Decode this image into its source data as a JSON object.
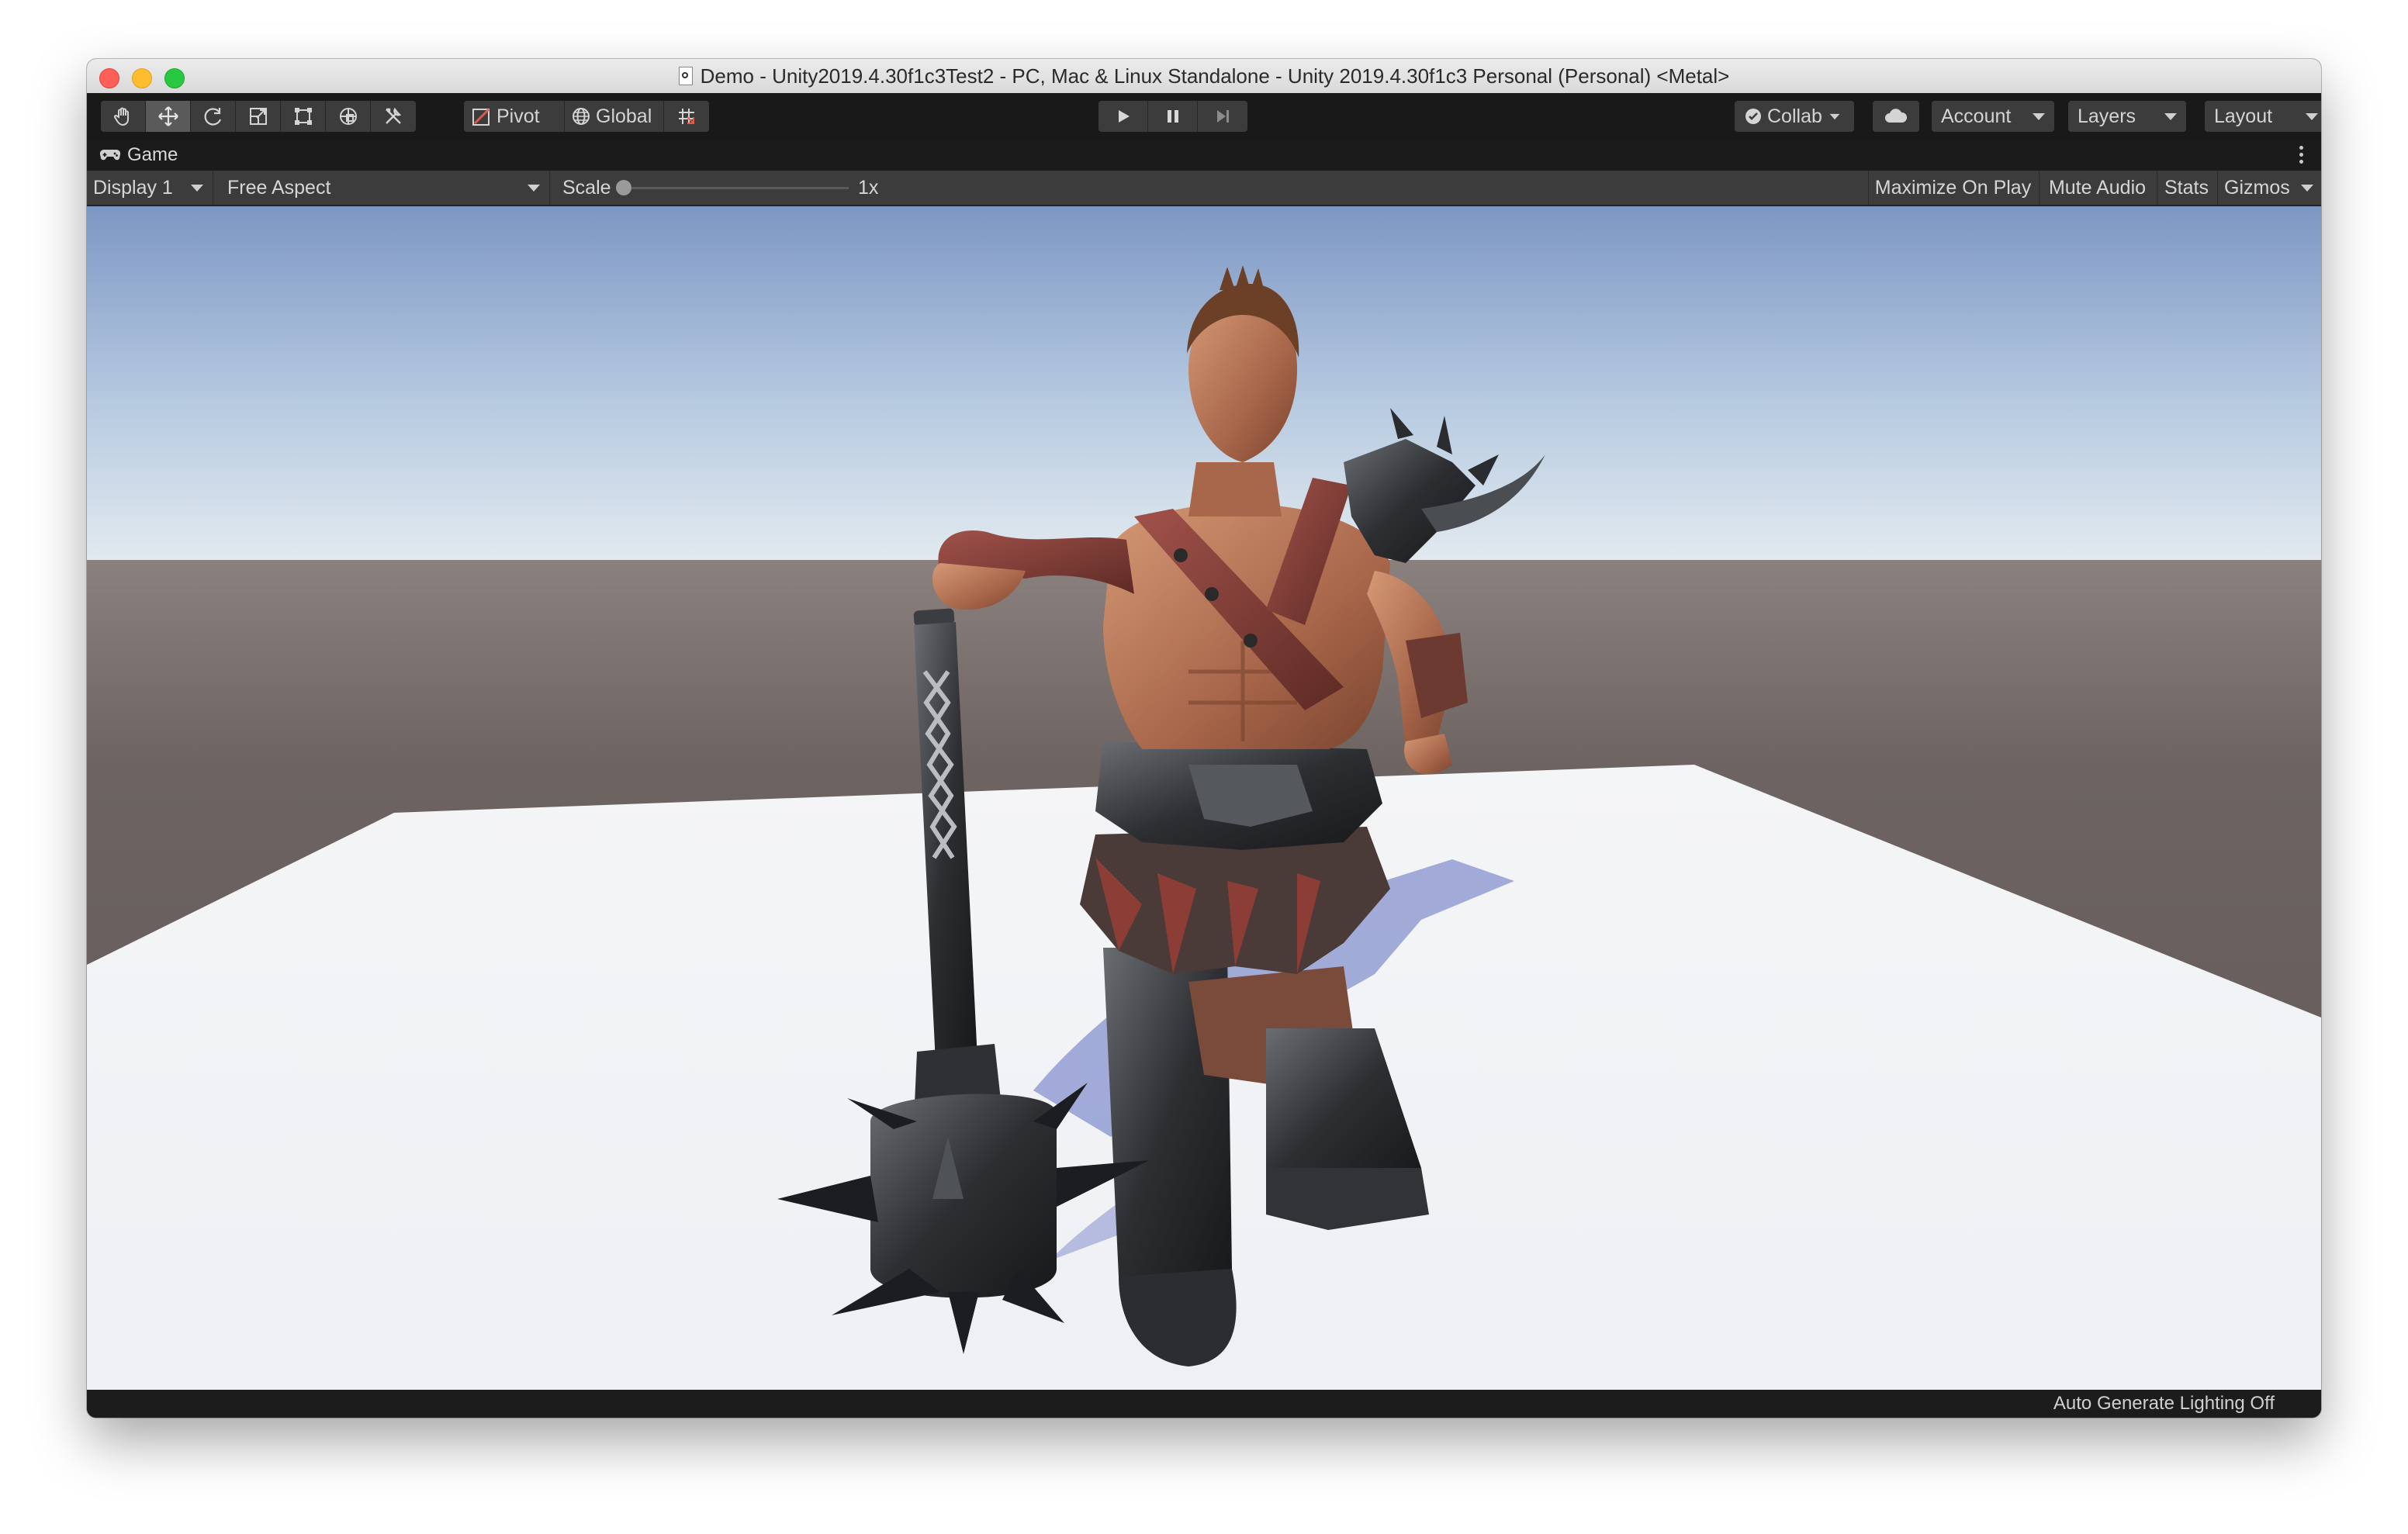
{
  "window": {
    "title": "Demo - Unity2019.4.30f1c3Test2 - PC, Mac & Linux Standalone - Unity 2019.4.30f1c3 Personal (Personal) <Metal>"
  },
  "toolbar": {
    "tools": [
      "hand-tool",
      "move-tool",
      "rotate-tool",
      "scale-tool",
      "rect-tool",
      "transform-tool",
      "custom-tool"
    ],
    "active_tool": "move-tool",
    "pivot_label": "Pivot",
    "global_label": "Global",
    "collab_label": "Collab",
    "account_label": "Account",
    "layers_label": "Layers",
    "layout_label": "Layout"
  },
  "game_tab": {
    "label": "Game"
  },
  "game_toolbar": {
    "display": "Display 1",
    "aspect": "Free Aspect",
    "scale_label": "Scale",
    "scale_value": "1x",
    "maximize_label": "Maximize On Play",
    "mute_label": "Mute Audio",
    "stats_label": "Stats",
    "gizmos_label": "Gizmos"
  },
  "status": {
    "text": "Auto Generate Lighting Off"
  },
  "colors": {
    "sky_top": "#7f9bc6",
    "horizon": "#dde6ee",
    "ground": "#6b615e",
    "plane": "#f2f3f5",
    "panel": "#3c3c3c",
    "toolbar": "#191919"
  }
}
